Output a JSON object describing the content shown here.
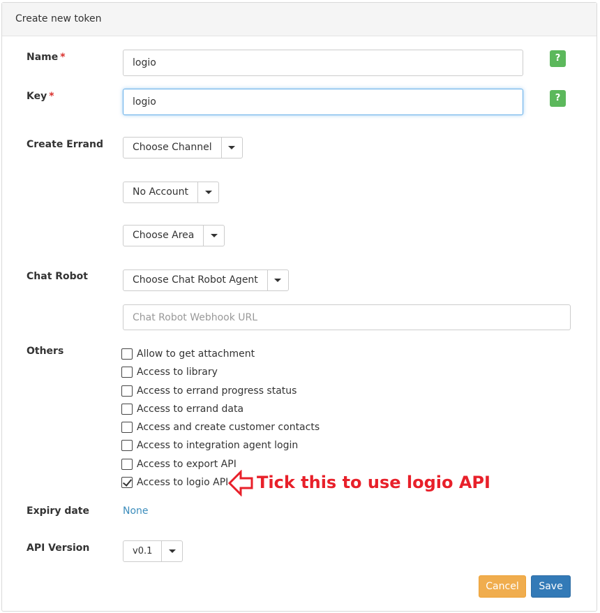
{
  "panel": {
    "title": "Create new token"
  },
  "fields": {
    "name": {
      "label": "Name",
      "required_mark": "*",
      "value": "logio",
      "help": "?"
    },
    "key": {
      "label": "Key",
      "required_mark": "*",
      "value": "logio",
      "help": "?"
    }
  },
  "create_errand": {
    "label": "Create Errand",
    "channel": "Choose Channel",
    "account": "No Account",
    "area": "Choose Area"
  },
  "chat_robot": {
    "label": "Chat Robot",
    "agent": "Choose Chat Robot Agent",
    "webhook_placeholder": "Chat Robot Webhook URL"
  },
  "others": {
    "label": "Others",
    "options": [
      {
        "label": "Allow to get attachment",
        "checked": false
      },
      {
        "label": "Access to library",
        "checked": false
      },
      {
        "label": "Access to errand progress status",
        "checked": false
      },
      {
        "label": "Access to errand data",
        "checked": false
      },
      {
        "label": "Access and create customer contacts",
        "checked": false
      },
      {
        "label": "Access to integration agent login",
        "checked": false
      },
      {
        "label": "Access to export API",
        "checked": false
      },
      {
        "label": "Access to logio API",
        "checked": true
      }
    ]
  },
  "annotation": {
    "text": "Tick this to use logio API",
    "color": "#e8202a"
  },
  "expiry": {
    "label": "Expiry date",
    "value": "None"
  },
  "api_version": {
    "label": "API Version",
    "value": "v0.1"
  },
  "buttons": {
    "cancel": "Cancel",
    "save": "Save"
  },
  "colors": {
    "help": "#5cb85c",
    "cancel": "#f0ad4e",
    "save": "#337ab7",
    "link": "#3c8dbc"
  }
}
